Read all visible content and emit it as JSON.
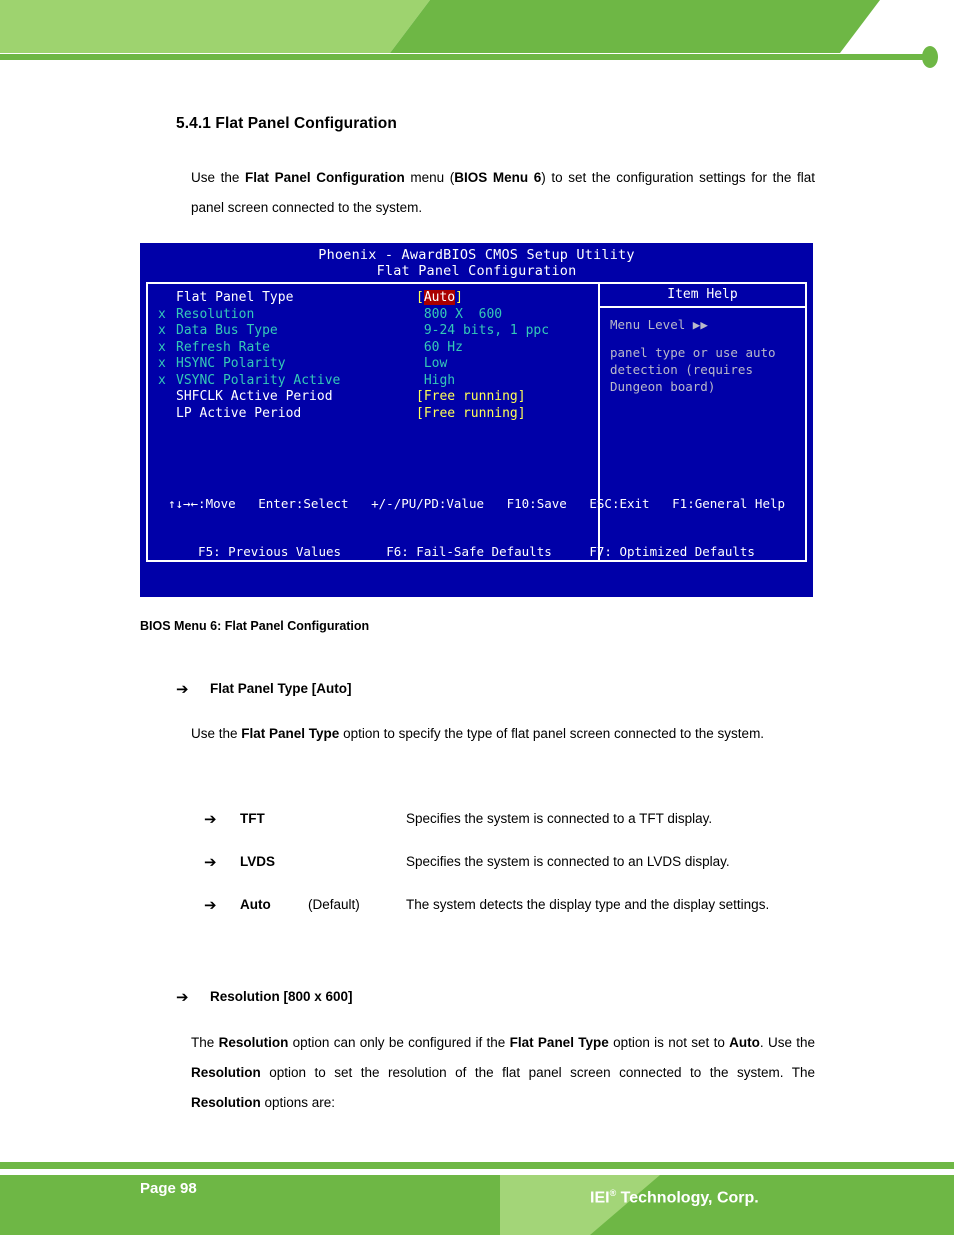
{
  "header": {
    "banner_light_color": "#9ed36f",
    "banner_dark_color": "#6eb745"
  },
  "section": {
    "number_title": "5.4.1 Flat Panel Configuration",
    "intro_parts": {
      "a": "Use the ",
      "b": "Flat Panel Configuration",
      "c": " menu (",
      "d": "BIOS Menu 6",
      "e": ") to set the configuration settings for the flat panel screen connected to the system."
    }
  },
  "bios": {
    "title_line1": "Phoenix - AwardBIOS CMOS Setup Utility",
    "title_line2": "Flat Panel Configuration",
    "rows": [
      {
        "mark": "",
        "label": "Flat Panel Type",
        "value_prefix": "[",
        "value": "Auto",
        "value_suffix": "]",
        "state": "enabled",
        "selected": true
      },
      {
        "mark": "x",
        "label": "Resolution",
        "value_prefix": "",
        "value": " 800 X  600",
        "value_suffix": "",
        "state": "disabled",
        "selected": false
      },
      {
        "mark": "x",
        "label": "Data Bus Type",
        "value_prefix": "",
        "value": " 9-24 bits, 1 ppc",
        "value_suffix": "",
        "state": "disabled",
        "selected": false
      },
      {
        "mark": "x",
        "label": "Refresh Rate",
        "value_prefix": "",
        "value": " 60 Hz",
        "value_suffix": "",
        "state": "disabled",
        "selected": false
      },
      {
        "mark": "x",
        "label": "HSYNC Polarity",
        "value_prefix": "",
        "value": " Low",
        "value_suffix": "",
        "state": "disabled",
        "selected": false
      },
      {
        "mark": "x",
        "label": "VSYNC Polarity Active",
        "value_prefix": "",
        "value": " High",
        "value_suffix": "",
        "state": "disabled",
        "selected": false
      },
      {
        "mark": "",
        "label": "SHFCLK Active Period",
        "value_prefix": "[",
        "value": "Free running",
        "value_suffix": "]",
        "state": "enabled",
        "selected": false
      },
      {
        "mark": "",
        "label": "LP Active Period",
        "value_prefix": "[",
        "value": "Free running",
        "value_suffix": "]",
        "state": "enabled",
        "selected": false
      }
    ],
    "help": {
      "title": "Item Help",
      "menu_level": "Menu Level",
      "menu_level_arrows": "▶▶",
      "text_line1": "panel type or use auto",
      "text_line2": "detection (requires",
      "text_line3": "Dungeon board)"
    },
    "footer_line1": "↑↓→←:Move   Enter:Select   +/-/PU/PD:Value   F10:Save   ESC:Exit   F1:General Help",
    "footer_line2": "F5: Previous Values      F6: Fail-Safe Defaults     F7: Optimized Defaults"
  },
  "caption": "BIOS Menu 6: Flat Panel Configuration",
  "flat_panel_type": {
    "arrow": "➔",
    "heading": "Flat Panel Type [Auto]",
    "desc_parts": {
      "a": "Use the ",
      "b": "Flat Panel Type",
      "c": " option to specify the type of flat panel screen connected to the system."
    },
    "options": [
      {
        "arrow": "➔",
        "name": "TFT",
        "default": "",
        "desc": "Specifies the system is connected to a TFT display."
      },
      {
        "arrow": "➔",
        "name": "LVDS",
        "default": "",
        "desc": "Specifies the system is connected to an LVDS display."
      },
      {
        "arrow": "➔",
        "name": "Auto",
        "default": "(Default)",
        "desc": "The system detects the display type and the display settings."
      }
    ]
  },
  "resolution": {
    "arrow": "➔",
    "heading": "Resolution [800 x 600]",
    "desc_parts": {
      "a": "The ",
      "b": "Resolution",
      "c": " option can only be configured if the ",
      "d": "Flat Panel Type",
      "e": " option is not set to ",
      "f": "Auto",
      "g": ". Use the ",
      "h": "Resolution",
      "i": " option to set the resolution of the flat panel screen connected to the system. The ",
      "j": "Resolution",
      "k": " options are:"
    }
  },
  "footer": {
    "page_label": "Page 98",
    "company_name": "IEI",
    "company_reg": "®",
    "company_suffix": " Technology, Corp.",
    "band_color": "#6eb745",
    "band_light_color": "#a3d578"
  }
}
